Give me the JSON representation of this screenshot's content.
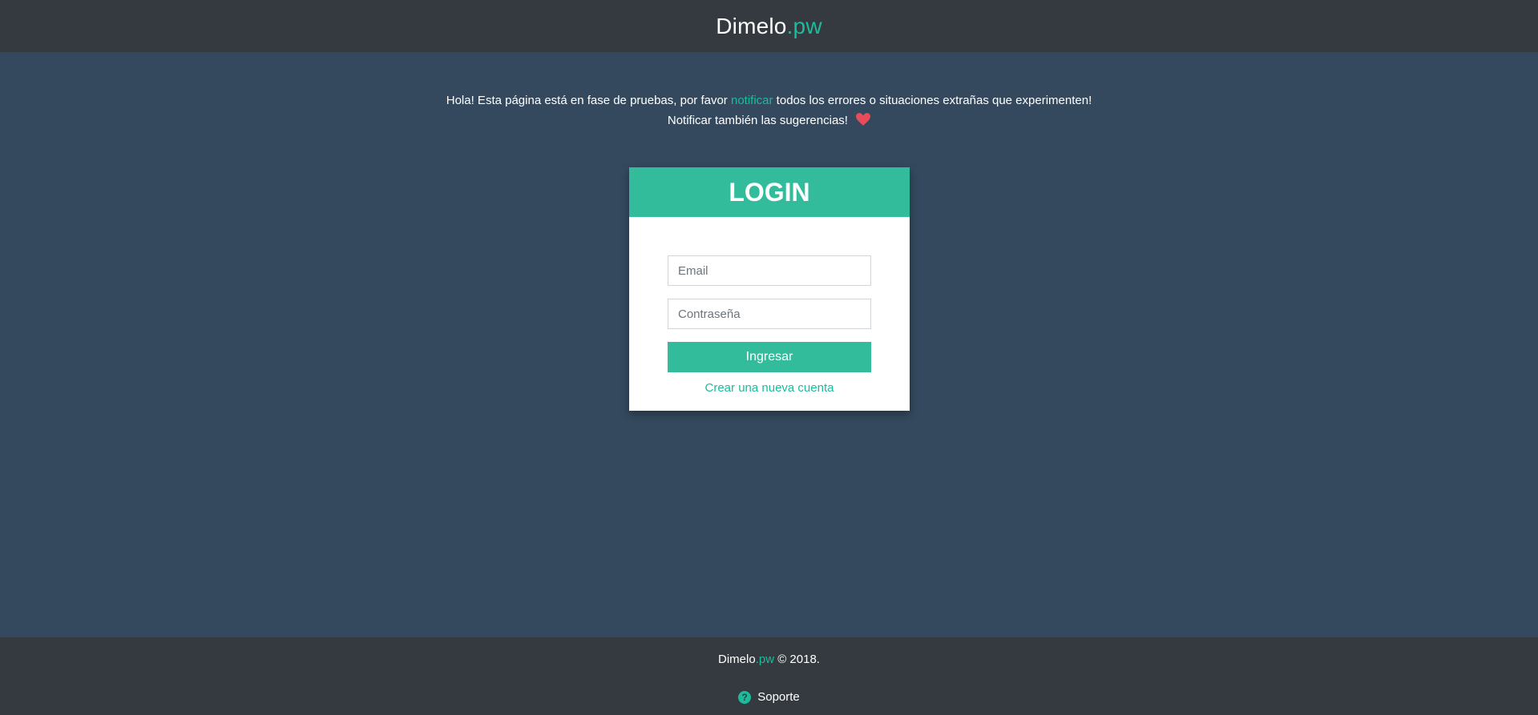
{
  "header": {
    "brand_name": "Dimelo",
    "brand_tld": ".pw"
  },
  "notice": {
    "line1_before": "Hola! Esta página está en fase de pruebas, por favor ",
    "line1_link": "notificar",
    "line1_after": " todos los errores o situaciones extrañas que experimenten!",
    "line2": "Notificar también las sugerencias!",
    "heart_icon": "heart-icon",
    "heart_color": "#e74c5b"
  },
  "login": {
    "title": "LOGIN",
    "email_placeholder": "Email",
    "password_placeholder": "Contraseña",
    "submit_label": "Ingresar",
    "create_account_label": "Crear una nueva cuenta"
  },
  "footer": {
    "brand_name": "Dimelo",
    "brand_tld": ".pw",
    "copyright": " © 2018.",
    "support_label": "Soporte",
    "support_icon": "question-circle-icon"
  },
  "colors": {
    "accent": "#1abc9c",
    "header_bg": "#343a40",
    "page_bg": "#34495e",
    "button_bg": "#33bc9c"
  }
}
